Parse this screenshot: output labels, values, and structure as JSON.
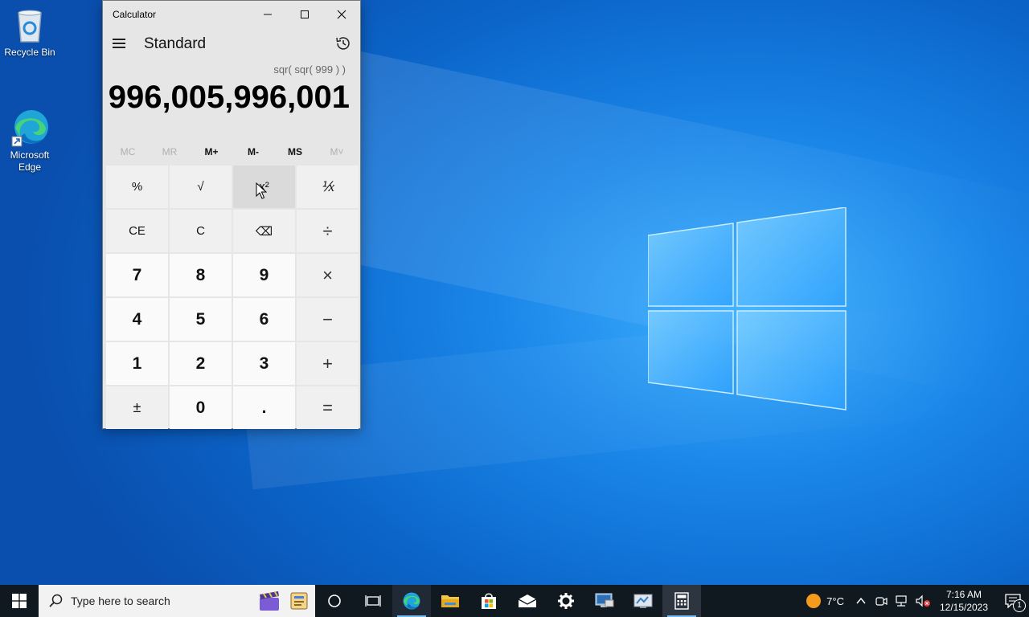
{
  "desktop": {
    "icons": [
      {
        "label": "Recycle Bin"
      },
      {
        "label": "Microsoft\nEdge"
      }
    ]
  },
  "calculator": {
    "window_title": "Calculator",
    "mode": "Standard",
    "expression": "sqr( sqr( 999 ) )",
    "display": "996,005,996,001",
    "memory": [
      "MC",
      "MR",
      "M+",
      "M-",
      "MS",
      "M˅"
    ],
    "keys": [
      "%",
      "√",
      "x²",
      "⅟x",
      "CE",
      "C",
      "⌫",
      "÷",
      "7",
      "8",
      "9",
      "×",
      "4",
      "5",
      "6",
      "−",
      "1",
      "2",
      "3",
      "+",
      "±",
      "0",
      ".",
      "="
    ]
  },
  "taskbar": {
    "search_placeholder": "Type here to search",
    "weather_temp": "7°C",
    "time": "7:16 AM",
    "date": "12/15/2023",
    "notification_count": "1"
  },
  "colors": {
    "accent": "#0a64c8",
    "taskbar": "#101820"
  }
}
